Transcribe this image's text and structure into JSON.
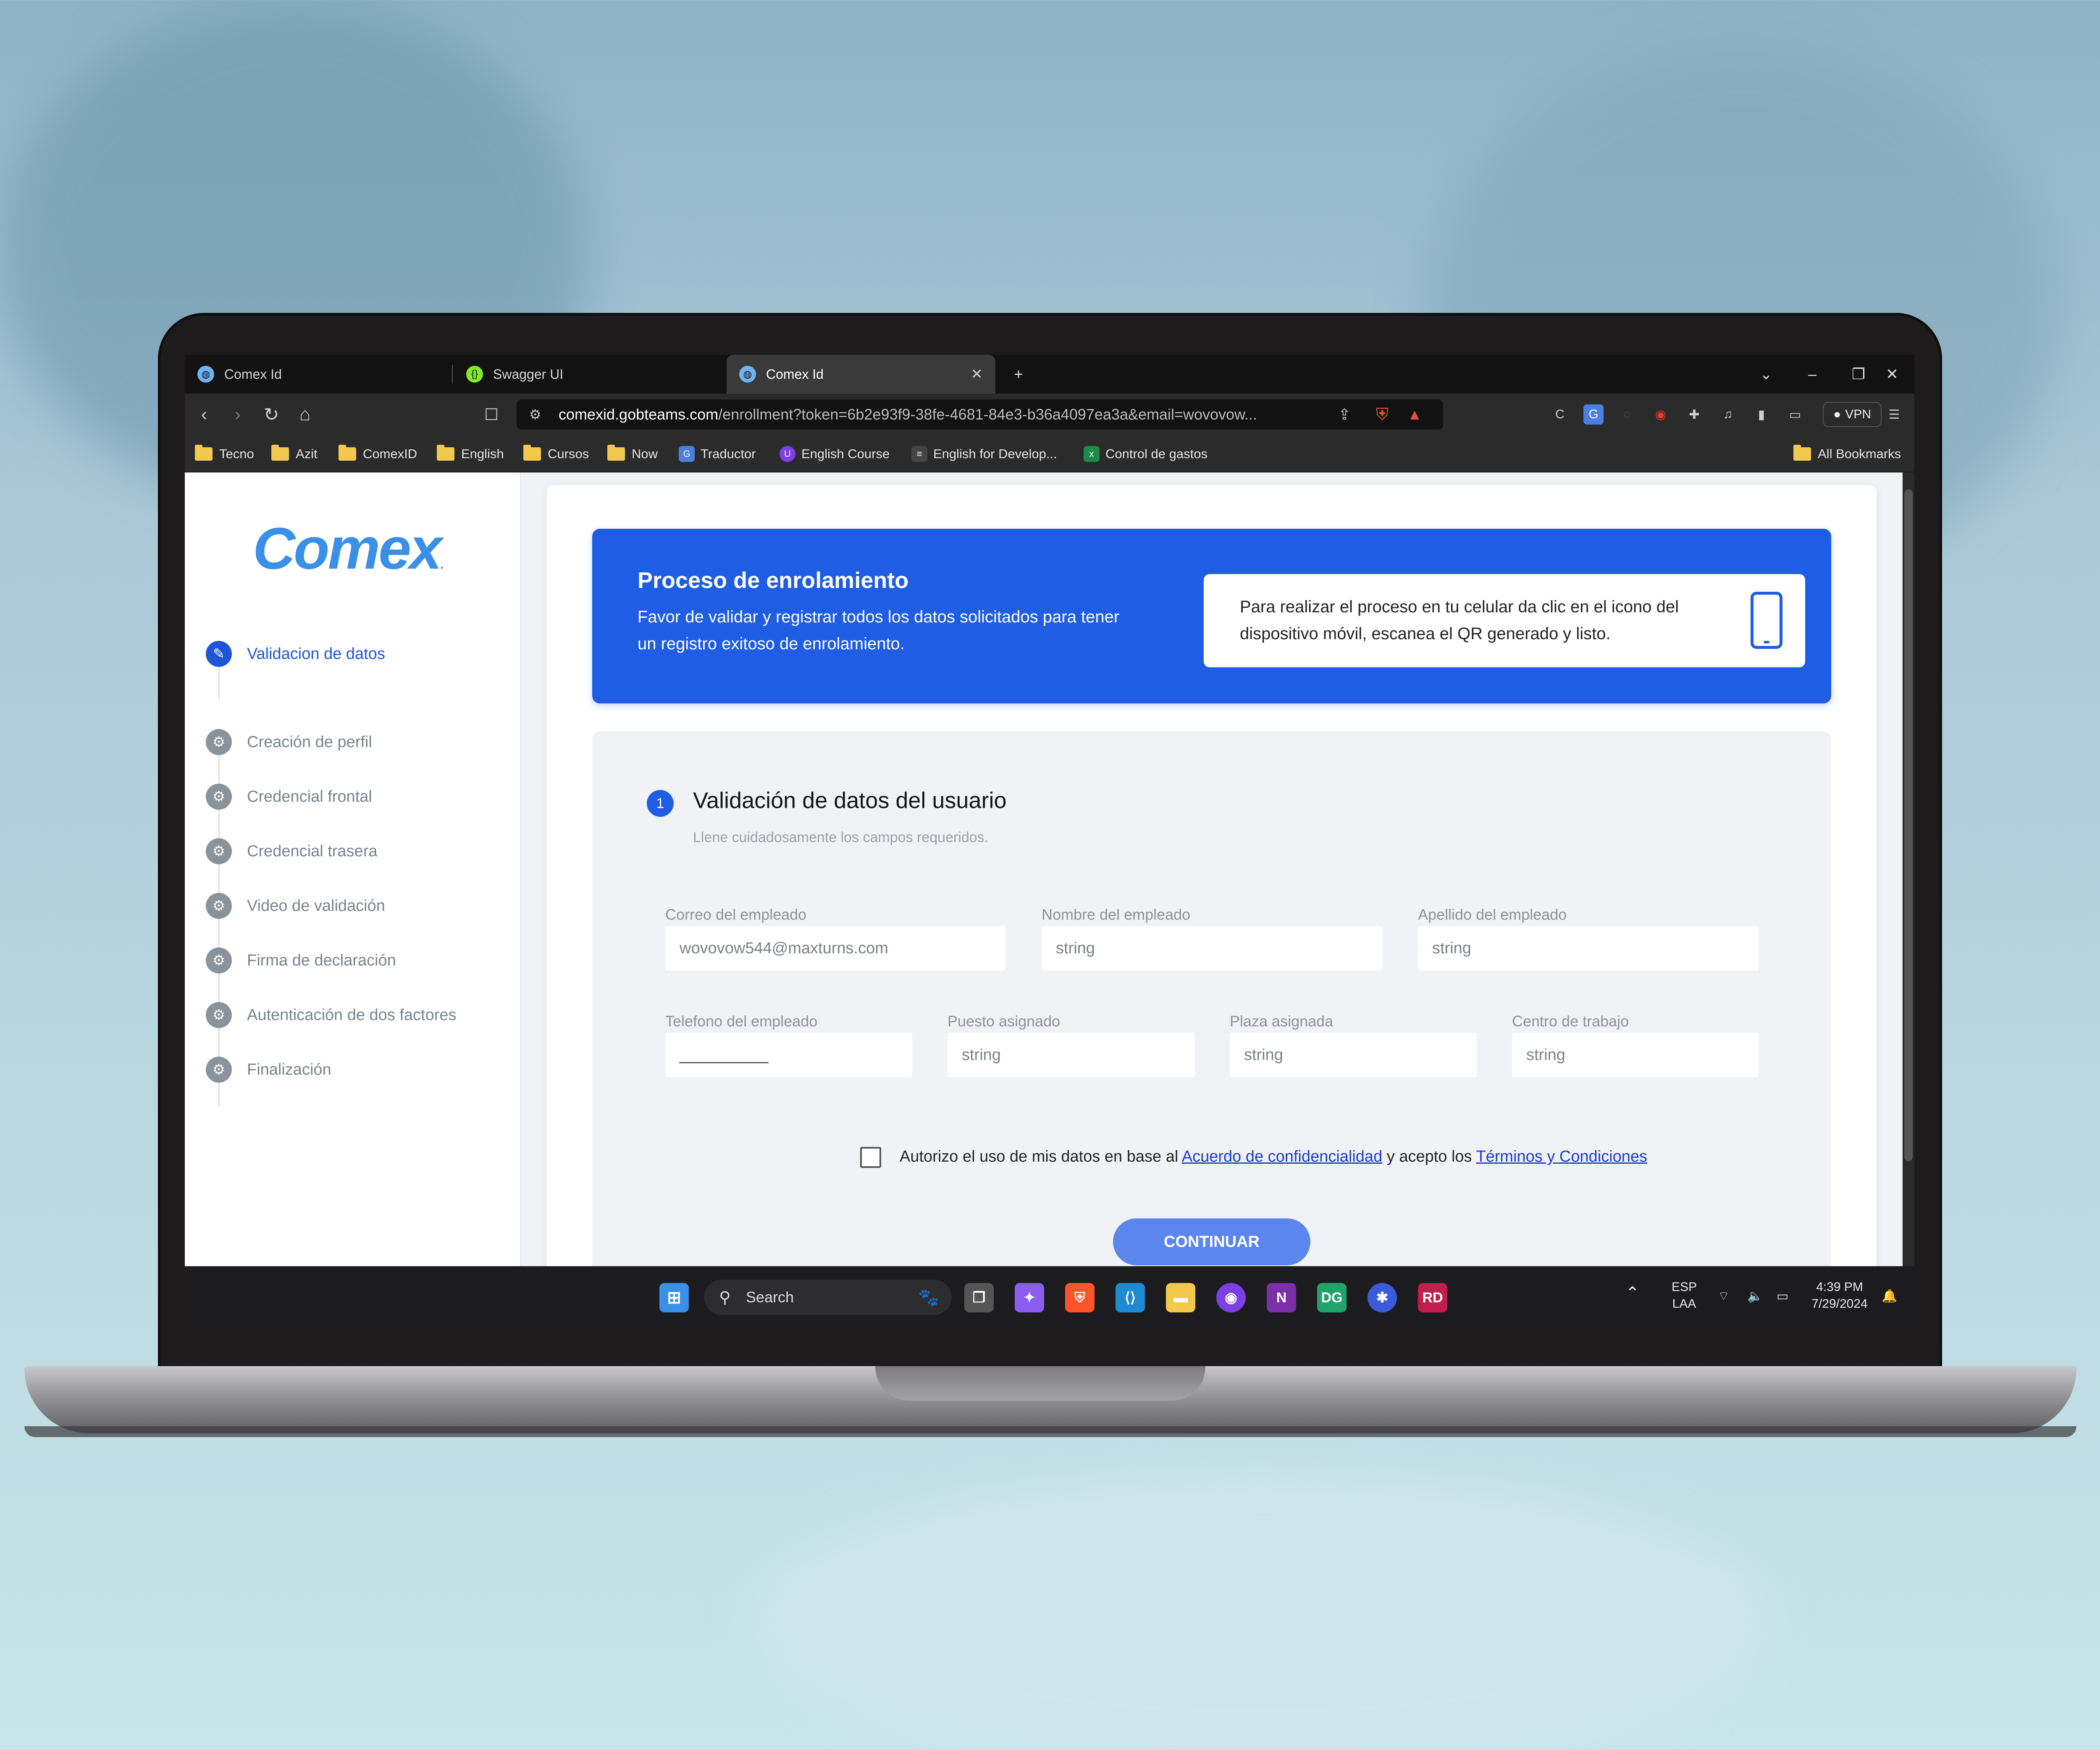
{
  "browser": {
    "tabs": [
      {
        "label": "Comex Id",
        "active": false
      },
      {
        "label": "Swagger UI",
        "active": false
      },
      {
        "label": "Comex Id",
        "active": true
      }
    ],
    "new_tab_symbol": "+",
    "url_host": "comexid.gobteams.com",
    "url_path": "/enrollment?token=6b2e93f9-38fe-4681-84e3-b36a4097ea3a&email=wovovow...",
    "vpn_label": "VPN",
    "bookmarks": [
      {
        "label": "Tecno",
        "type": "folder"
      },
      {
        "label": "Azit",
        "type": "folder"
      },
      {
        "label": "ComexID",
        "type": "folder"
      },
      {
        "label": "English",
        "type": "folder"
      },
      {
        "label": "Cursos",
        "type": "folder"
      },
      {
        "label": "Now",
        "type": "folder"
      },
      {
        "label": "Traductor",
        "type": "translate-icon"
      },
      {
        "label": "English Course",
        "type": "course-icon"
      },
      {
        "label": "English for Develop...",
        "type": "doc-icon"
      },
      {
        "label": "Control de gastos",
        "type": "sheet-icon"
      }
    ],
    "all_bookmarks_label": "All Bookmarks"
  },
  "sidebar": {
    "logo": "Comex",
    "steps": [
      {
        "label": "Validacion de datos",
        "active": true
      },
      {
        "label": "Creación de perfil",
        "active": false
      },
      {
        "label": "Credencial frontal",
        "active": false
      },
      {
        "label": "Credencial trasera",
        "active": false
      },
      {
        "label": "Video de validación",
        "active": false
      },
      {
        "label": "Firma de declaración",
        "active": false
      },
      {
        "label": "Autenticación de dos factores",
        "active": false
      },
      {
        "label": "Finalización",
        "active": false
      }
    ]
  },
  "banner": {
    "title": "Proceso de enrolamiento",
    "text": "Favor de validar y registrar todos los datos solicitados para tener un registro exitoso de enrolamiento.",
    "box_text": "Para realizar el proceso en tu celular da clic en el icono del dispositivo móvil, escanea el QR generado y listo."
  },
  "form": {
    "step_number": "1",
    "title": "Validación de datos del usuario",
    "subtitle": "Llene cuidadosamente los campos requeridos.",
    "fields": {
      "correo": {
        "label": "Correo del empleado",
        "value": "wovovow544@maxturns.com"
      },
      "nombre": {
        "label": "Nombre del empleado",
        "value": "string"
      },
      "apellido": {
        "label": "Apellido del empleado",
        "value": "string"
      },
      "telefono": {
        "label": "Telefono del empleado",
        "value": "__________"
      },
      "puesto": {
        "label": "Puesto asignado",
        "value": "string"
      },
      "plaza": {
        "label": "Plaza asignada",
        "value": "string"
      },
      "centro": {
        "label": "Centro de trabajo",
        "value": "string"
      }
    },
    "consent_prefix": "Autorizo el uso de mis datos en base al ",
    "consent_link1": "Acuerdo de confidencialidad",
    "consent_middle": " y acepto los ",
    "consent_link2": "Términos y Condiciones",
    "continue_label": "CONTINUAR"
  },
  "taskbar": {
    "search_label": "Search",
    "lang_top": "ESP",
    "lang_bottom": "LAA",
    "time": "4:39 PM",
    "date": "7/29/2024"
  }
}
